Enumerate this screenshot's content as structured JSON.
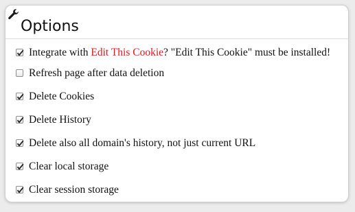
{
  "header": {
    "title": "Options",
    "icon": "wrench-icon"
  },
  "colors": {
    "link": "#e2141d",
    "panel_background": "#ffffff",
    "page_background": "#ececec"
  },
  "options": [
    {
      "id": "integrate",
      "checked": true,
      "prefix": "Integrate with ",
      "link_text": "Edit This Cookie",
      "suffix": "? \"Edit This Cookie\" must be installed!"
    },
    {
      "id": "refresh",
      "checked": false,
      "label": "Refresh page after data deletion"
    },
    {
      "id": "delete-cookies",
      "checked": true,
      "label": "Delete Cookies"
    },
    {
      "id": "delete-history",
      "checked": true,
      "label": "Delete History"
    },
    {
      "id": "delete-domain-history",
      "checked": true,
      "label": "Delete also all domain's history, not just current URL"
    },
    {
      "id": "clear-local-storage",
      "checked": true,
      "label": "Clear local storage"
    },
    {
      "id": "clear-session-storage",
      "checked": true,
      "label": "Clear session storage"
    }
  ]
}
